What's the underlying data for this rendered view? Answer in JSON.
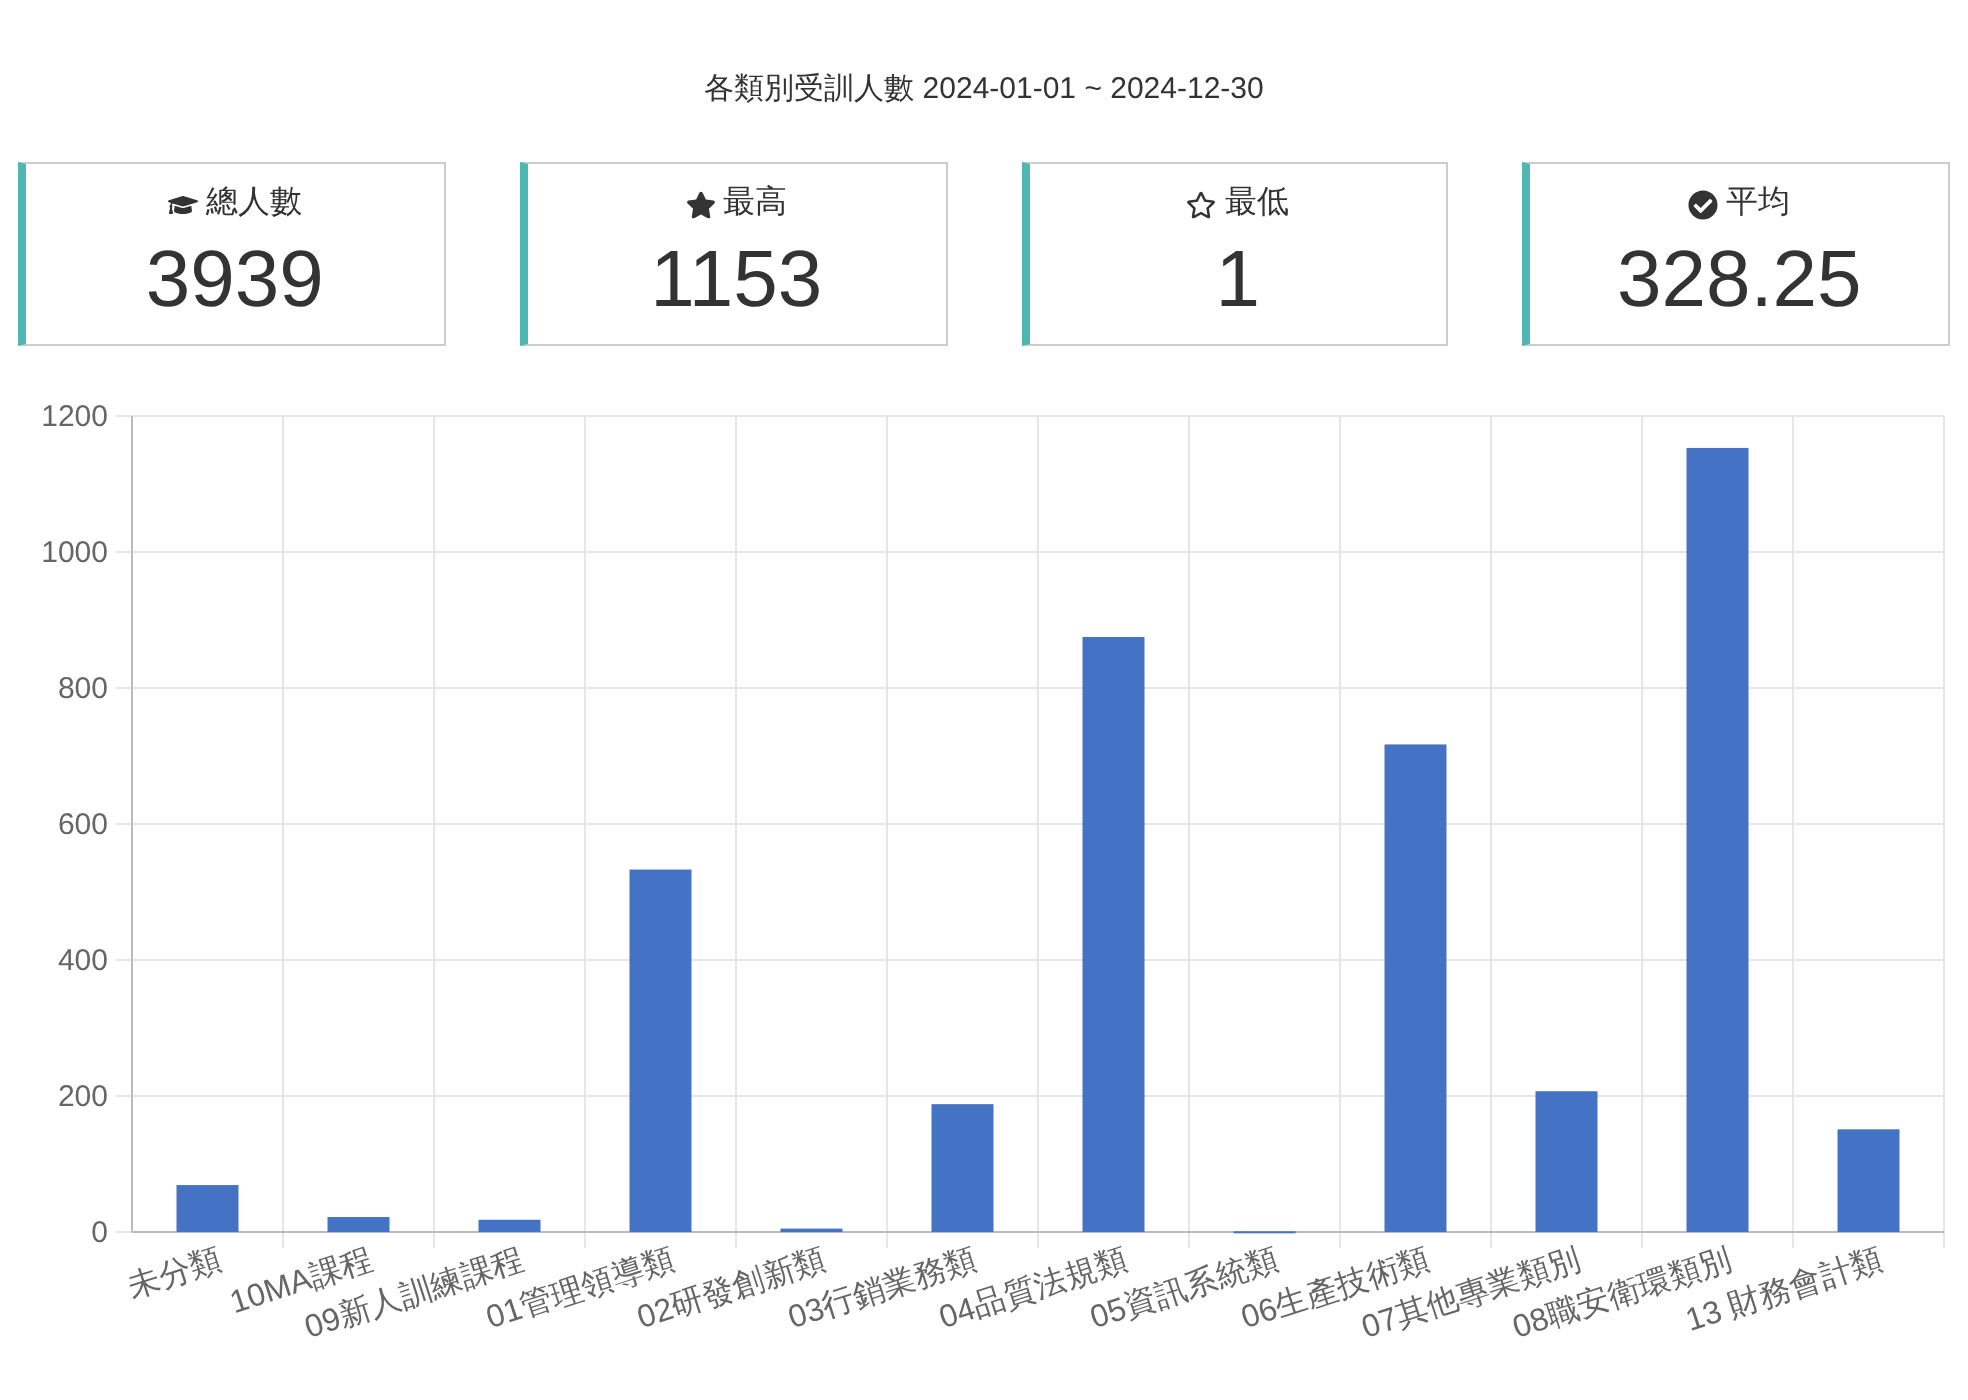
{
  "title": "各類別受訓人數 2024-01-01 ~ 2024-12-30",
  "stats": [
    {
      "kind": "cap",
      "label": "總人數",
      "value": "3939"
    },
    {
      "kind": "star",
      "label": "最高",
      "value": "1153"
    },
    {
      "kind": "star-outline",
      "label": "最低",
      "value": "1"
    },
    {
      "kind": "check",
      "label": "平均",
      "value": "328.25"
    }
  ],
  "chart": {
    "chart_data": {
      "type": "bar",
      "categories": [
        "未分類",
        "10MA課程",
        "09新人訓練課程",
        "01管理領導類",
        "02研發創新類",
        "03行銷業務類",
        "04品質法規類",
        "05資訊系統類",
        "06生產技術類",
        "07其他專業類別",
        "08職安衛環類別",
        "13 財務會計類"
      ],
      "series": [
        {
          "color": "#4472c4",
          "values": [
            69,
            22,
            18,
            533,
            5,
            188,
            875,
            1,
            717,
            207,
            1153,
            151
          ]
        }
      ],
      "grid": true,
      "ylim": [
        0,
        1200
      ],
      "yticks": [
        0,
        200,
        400,
        600,
        800,
        1000,
        1200
      ]
    }
  }
}
